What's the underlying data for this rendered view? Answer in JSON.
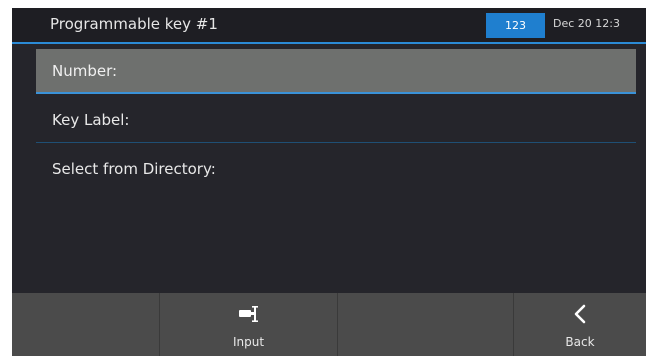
{
  "header": {
    "title": "Programmable key #1",
    "input_mode": "123",
    "datetime": "Dec 20 12:3"
  },
  "menu": {
    "items": [
      {
        "label": "Number:",
        "selected": true
      },
      {
        "label": "Key Label:"
      },
      {
        "label": "Select from Directory:"
      }
    ]
  },
  "softkeys": [
    {
      "label": "",
      "icon": ""
    },
    {
      "label": "Input",
      "icon": "input-icon"
    },
    {
      "label": "",
      "icon": ""
    },
    {
      "label": "Back",
      "icon": "back-chevron-icon"
    }
  ],
  "colors": {
    "accent": "#2b8bd6",
    "background": "#25252b",
    "selected_row": "#6e706e",
    "softkey_bar": "#4b4b4b"
  }
}
